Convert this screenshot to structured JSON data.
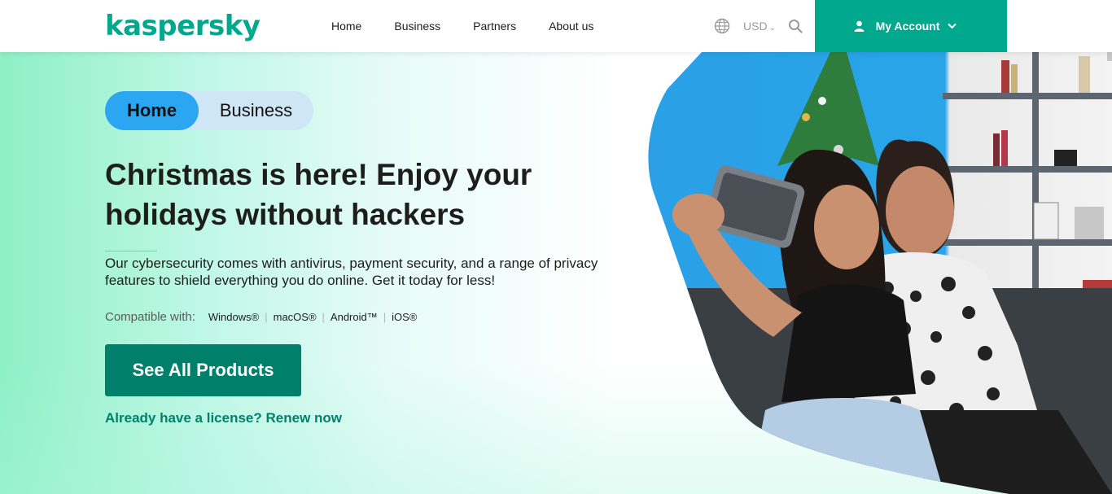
{
  "header": {
    "logo": "kaspersky",
    "nav": [
      "Home",
      "Business",
      "Partners",
      "About us"
    ],
    "currency": "USD",
    "account_label": "My Account"
  },
  "hero": {
    "toggle": {
      "home": "Home",
      "business": "Business"
    },
    "headline_line1": "Christmas is here! Enjoy your",
    "headline_line2": "holidays without hackers",
    "description": "Our cybersecurity comes with antivirus, payment security, and a range of privacy features to shield everything you do online. Get it today for less!",
    "compatible_label": "Compatible with:",
    "platforms": [
      "Windows®",
      "macOS®",
      "Android™",
      "iOS®"
    ],
    "cta_label": "See All Products",
    "renew_link": "Already have a license? Renew now"
  },
  "colors": {
    "brand": "#00a88e",
    "cta": "#00806a",
    "toggle_active": "#2aa7f0",
    "sky": "#29a5e8"
  },
  "icons": [
    "globe-icon",
    "chevron-down-icon",
    "search-icon",
    "user-icon"
  ]
}
